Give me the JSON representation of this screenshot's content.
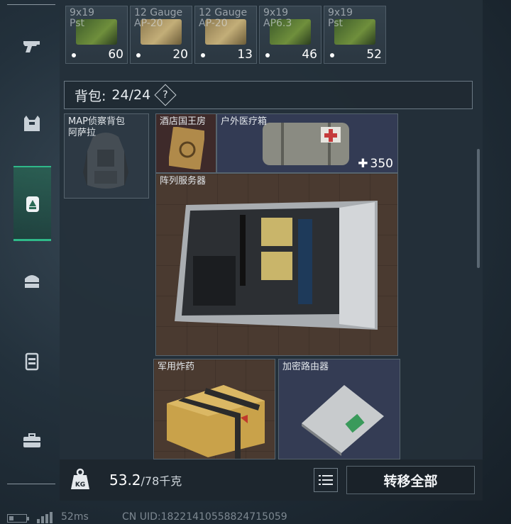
{
  "rail": {
    "items": [
      {
        "icon": "pistol-icon"
      },
      {
        "icon": "vest-icon"
      },
      {
        "icon": "backpack-active-icon"
      },
      {
        "icon": "pouch-icon"
      },
      {
        "icon": "case-icon"
      },
      {
        "icon": "briefcase-icon"
      }
    ],
    "accent": "#2fb989"
  },
  "ammo": [
    {
      "caliber": "9x19\nPst",
      "qty": "60",
      "color": "green"
    },
    {
      "caliber": "12 Gauge\nAP-20",
      "qty": "20",
      "color": "tan"
    },
    {
      "caliber": "12 Gauge\nAP-20",
      "qty": "13",
      "color": "tan"
    },
    {
      "caliber": "9x19\nAP6.3",
      "qty": "46",
      "color": "green"
    },
    {
      "caliber": "9x19\nPst",
      "qty": "52",
      "color": "green"
    }
  ],
  "backpack": {
    "label": "背包:",
    "capacity": "24/24",
    "help": "?"
  },
  "items": {
    "recon": "MAP侦察背包\n阿萨拉",
    "key": "酒店国王房",
    "medkit": "户外医疗箱",
    "medkit_value": "350",
    "server": "阵列服务器",
    "explosive": "军用炸药",
    "router": "加密路由器"
  },
  "bottom": {
    "weight": "53.2",
    "max_weight": "/78千克",
    "kg_label": "KG",
    "transfer_label": "转移全部"
  },
  "status": {
    "ping": "52ms",
    "uid": "CN UID:18221410558824715059"
  }
}
